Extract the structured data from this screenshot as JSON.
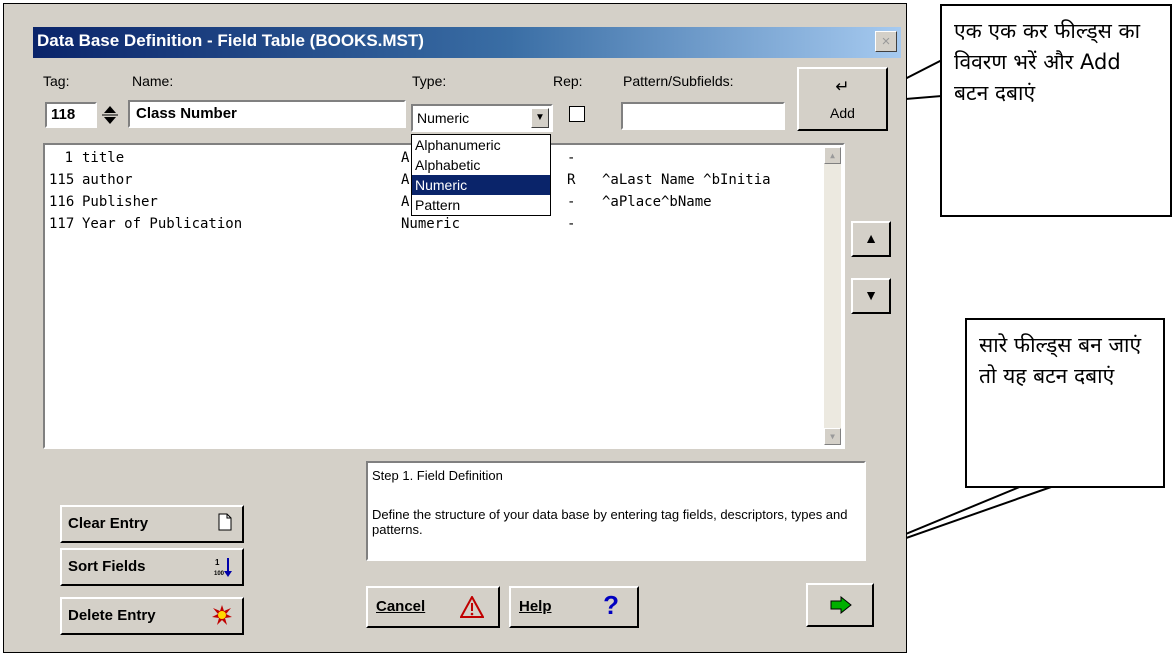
{
  "window": {
    "title": "Data Base Definition - Field Table (BOOKS.MST)",
    "close_glyph": "×"
  },
  "labels": {
    "tag": "Tag:",
    "name": "Name:",
    "type": "Type:",
    "rep": "Rep:",
    "pattern": "Pattern/Subfields:"
  },
  "inputs": {
    "tag": "118",
    "name": "Class Number",
    "type_selected": "Numeric",
    "rep_checked": false,
    "pattern": ""
  },
  "type_options": [
    "Alphanumeric",
    "Alphabetic",
    "Numeric",
    "Pattern"
  ],
  "field_table": {
    "rows": [
      {
        "tag": "1",
        "name": "title",
        "type": "A",
        "rep": "-",
        "pattern": ""
      },
      {
        "tag": "115",
        "name": "author",
        "type": "A",
        "rep": "R",
        "pattern": "^aLast Name ^bInitia"
      },
      {
        "tag": "116",
        "name": "Publisher",
        "type": "A",
        "rep": "-",
        "pattern": "^aPlace^bName"
      },
      {
        "tag": "117",
        "name": "Year of Publication",
        "type": "Numeric",
        "rep": "-",
        "pattern": ""
      }
    ]
  },
  "buttons": {
    "add": "Add",
    "add_icon": "enter-arrow-icon",
    "clear_entry": "Clear Entry",
    "sort_fields": "Sort Fields",
    "delete_entry": "Delete Entry",
    "cancel": "Cancel",
    "help": "Help",
    "next_icon": "right-arrow-icon"
  },
  "help_text": {
    "step": "Step 1. Field Definition",
    "body": "Define the structure of your data base by entering tag fields, descriptors, types and patterns."
  },
  "callouts": {
    "add": "एक एक कर फील्ड्स का विवरण भरें और Add बटन दबाएं",
    "finish": "सारे फील्ड्स बन जाएं तो यह बटन दबाएं"
  },
  "colors": {
    "titlebar_start": "#0a246a",
    "titlebar_end": "#a6caf0",
    "dialog_bg": "#d4d0c8",
    "selection": "#0a246a"
  }
}
